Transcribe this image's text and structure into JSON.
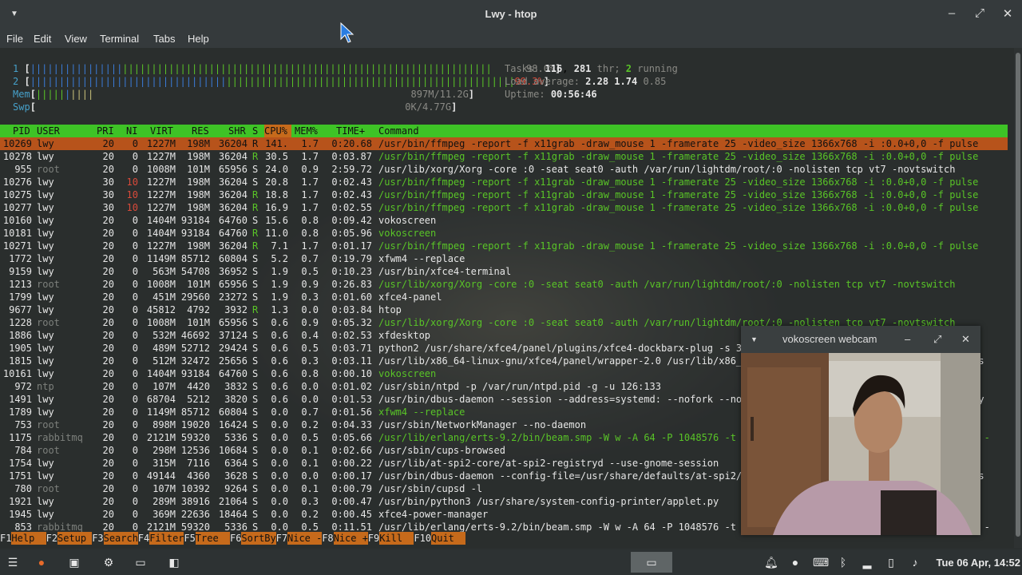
{
  "window": {
    "title": "Lwy - htop",
    "menu_icon": "chevron-down-icon",
    "minimize": "–",
    "maximize": "⤢",
    "close": "✕"
  },
  "menu": [
    "File",
    "Edit",
    "View",
    "Terminal",
    "Tabs",
    "Help"
  ],
  "meters": {
    "cpu1": {
      "label": "1",
      "value": "98.0%"
    },
    "cpu2": {
      "label": "2",
      "value": "99.3%"
    },
    "mem": {
      "label": "Mem",
      "value": "897M/11.2G"
    },
    "swp": {
      "label": "Swp",
      "value": "0K/4.77G"
    },
    "tasks_label": "Tasks:",
    "tasks": "116",
    "thr_count": "281",
    "thr_label": "thr;",
    "running": "2",
    "running_label": "running",
    "load_label": "Load average:",
    "load1": "2.28",
    "load5": "1.74",
    "load15": "0.85",
    "uptime_label": "Uptime:",
    "uptime": "00:56:46"
  },
  "columns": [
    "PID",
    "USER",
    "PRI",
    "NI",
    "VIRT",
    "RES",
    "SHR",
    "S",
    "CPU%",
    "MEM%",
    "TIME+",
    "Command"
  ],
  "processes": [
    {
      "pid": "10269",
      "user": "lwy",
      "pri": "20",
      "ni": "0",
      "virt": "1227M",
      "res": "198M",
      "shr": "36204",
      "s": "R",
      "cpu": "141.",
      "mem": "1.7",
      "time": "0:20.68",
      "cmd": "/usr/bin/ffmpeg -report -f x11grab -draw_mouse 1 -framerate 25 -video_size 1366x768 -i :0.0+0,0 -f pulse",
      "sel": true
    },
    {
      "pid": "10278",
      "user": "lwy",
      "pri": "20",
      "ni": "0",
      "virt": "1227M",
      "res": "198M",
      "shr": "36204",
      "s": "R",
      "cpu": "30.5",
      "mem": "1.7",
      "time": "0:03.87",
      "cmd": "/usr/bin/ffmpeg -report -f x11grab -draw_mouse 1 -framerate 25 -video_size 1366x768 -i :0.0+0,0 -f pulse",
      "thread": true
    },
    {
      "pid": "955",
      "user": "root",
      "pri": "20",
      "ni": "0",
      "virt": "1008M",
      "res": "101M",
      "shr": "65956",
      "s": "S",
      "cpu": "24.0",
      "mem": "0.9",
      "time": "2:59.72",
      "cmd": "/usr/lib/xorg/Xorg -core :0 -seat seat0 -auth /var/run/lightdm/root/:0 -nolisten tcp vt7 -novtswitch"
    },
    {
      "pid": "10276",
      "user": "lwy",
      "pri": "30",
      "ni": "10",
      "virt": "1227M",
      "res": "198M",
      "shr": "36204",
      "s": "S",
      "cpu": "20.8",
      "mem": "1.7",
      "time": "0:02.43",
      "cmd": "/usr/bin/ffmpeg -report -f x11grab -draw_mouse 1 -framerate 25 -video_size 1366x768 -i :0.0+0,0 -f pulse",
      "thread": true
    },
    {
      "pid": "10275",
      "user": "lwy",
      "pri": "30",
      "ni": "10",
      "virt": "1227M",
      "res": "198M",
      "shr": "36204",
      "s": "R",
      "cpu": "18.8",
      "mem": "1.7",
      "time": "0:02.43",
      "cmd": "/usr/bin/ffmpeg -report -f x11grab -draw_mouse 1 -framerate 25 -video_size 1366x768 -i :0.0+0,0 -f pulse",
      "thread": true
    },
    {
      "pid": "10277",
      "user": "lwy",
      "pri": "30",
      "ni": "10",
      "virt": "1227M",
      "res": "198M",
      "shr": "36204",
      "s": "R",
      "cpu": "16.9",
      "mem": "1.7",
      "time": "0:02.55",
      "cmd": "/usr/bin/ffmpeg -report -f x11grab -draw_mouse 1 -framerate 25 -video_size 1366x768 -i :0.0+0,0 -f pulse",
      "thread": true
    },
    {
      "pid": "10160",
      "user": "lwy",
      "pri": "20",
      "ni": "0",
      "virt": "1404M",
      "res": "93184",
      "shr": "64760",
      "s": "S",
      "cpu": "15.6",
      "mem": "0.8",
      "time": "0:09.42",
      "cmd": "vokoscreen"
    },
    {
      "pid": "10181",
      "user": "lwy",
      "pri": "20",
      "ni": "0",
      "virt": "1404M",
      "res": "93184",
      "shr": "64760",
      "s": "R",
      "cpu": "11.0",
      "mem": "0.8",
      "time": "0:05.96",
      "cmd": "vokoscreen",
      "thread": true
    },
    {
      "pid": "10271",
      "user": "lwy",
      "pri": "20",
      "ni": "0",
      "virt": "1227M",
      "res": "198M",
      "shr": "36204",
      "s": "R",
      "cpu": "7.1",
      "mem": "1.7",
      "time": "0:01.17",
      "cmd": "/usr/bin/ffmpeg -report -f x11grab -draw_mouse 1 -framerate 25 -video_size 1366x768 -i :0.0+0,0 -f pulse",
      "thread": true
    },
    {
      "pid": "1772",
      "user": "lwy",
      "pri": "20",
      "ni": "0",
      "virt": "1149M",
      "res": "85712",
      "shr": "60804",
      "s": "S",
      "cpu": "5.2",
      "mem": "0.7",
      "time": "0:19.79",
      "cmd": "xfwm4 --replace"
    },
    {
      "pid": "9159",
      "user": "lwy",
      "pri": "20",
      "ni": "0",
      "virt": "563M",
      "res": "54708",
      "shr": "36952",
      "s": "S",
      "cpu": "1.9",
      "mem": "0.5",
      "time": "0:10.23",
      "cmd": "/usr/bin/xfce4-terminal"
    },
    {
      "pid": "1213",
      "user": "root",
      "pri": "20",
      "ni": "0",
      "virt": "1008M",
      "res": "101M",
      "shr": "65956",
      "s": "S",
      "cpu": "1.9",
      "mem": "0.9",
      "time": "0:26.83",
      "cmd": "/usr/lib/xorg/Xorg -core :0 -seat seat0 -auth /var/run/lightdm/root/:0 -nolisten tcp vt7 -novtswitch",
      "thread": true
    },
    {
      "pid": "1799",
      "user": "lwy",
      "pri": "20",
      "ni": "0",
      "virt": "451M",
      "res": "29560",
      "shr": "23272",
      "s": "S",
      "cpu": "1.9",
      "mem": "0.3",
      "time": "0:01.60",
      "cmd": "xfce4-panel"
    },
    {
      "pid": "9677",
      "user": "lwy",
      "pri": "20",
      "ni": "0",
      "virt": "45812",
      "res": "4792",
      "shr": "3932",
      "s": "R",
      "cpu": "1.3",
      "mem": "0.0",
      "time": "0:03.84",
      "cmd": "htop"
    },
    {
      "pid": "1228",
      "user": "root",
      "pri": "20",
      "ni": "0",
      "virt": "1008M",
      "res": "101M",
      "shr": "65956",
      "s": "S",
      "cpu": "0.6",
      "mem": "0.9",
      "time": "0:05.32",
      "cmd": "/usr/lib/xorg/Xorg -core :0 -seat seat0 -auth /var/run/lightdm/root/:0 -nolisten tcp vt7 -novtswitch",
      "thread": true
    },
    {
      "pid": "1886",
      "user": "lwy",
      "pri": "20",
      "ni": "0",
      "virt": "532M",
      "res": "46692",
      "shr": "37124",
      "s": "S",
      "cpu": "0.6",
      "mem": "0.4",
      "time": "0:02.53",
      "cmd": "xfdesktop"
    },
    {
      "pid": "1905",
      "user": "lwy",
      "pri": "20",
      "ni": "0",
      "virt": "489M",
      "res": "52712",
      "shr": "29424",
      "s": "S",
      "cpu": "0.6",
      "mem": "0.5",
      "time": "0:03.71",
      "cmd": "python2 /usr/share/xfce4/panel/plugins/xfce4-dockbarx-plug -s 356616(? -i 21"
    },
    {
      "pid": "1815",
      "user": "lwy",
      "pri": "20",
      "ni": "0",
      "virt": "512M",
      "res": "32472",
      "shr": "25656",
      "s": "S",
      "cpu": "0.6",
      "mem": "0.3",
      "time": "0:03.11",
      "cmd": "/usr/lib/x86_64-linux-gnu/xfce4/panel/wrapper-2.0 /usr/lib/x86_64-linux-gnu/xfce4/panel/plugins/libstatus"
    },
    {
      "pid": "10161",
      "user": "lwy",
      "pri": "20",
      "ni": "0",
      "virt": "1404M",
      "res": "93184",
      "shr": "64760",
      "s": "S",
      "cpu": "0.6",
      "mem": "0.8",
      "time": "0:00.10",
      "cmd": "vokoscreen",
      "thread": true
    },
    {
      "pid": "972",
      "user": "ntp",
      "pri": "20",
      "ni": "0",
      "virt": "107M",
      "res": "4420",
      "shr": "3832",
      "s": "S",
      "cpu": "0.6",
      "mem": "0.0",
      "time": "0:01.02",
      "cmd": "/usr/sbin/ntpd -p /var/run/ntpd.pid -g -u 126:133"
    },
    {
      "pid": "1491",
      "user": "lwy",
      "pri": "20",
      "ni": "0",
      "virt": "68704",
      "res": "5212",
      "shr": "3820",
      "s": "S",
      "cpu": "0.6",
      "mem": "0.0",
      "time": "0:01.53",
      "cmd": "/usr/bin/dbus-daemon --session --address=systemd: --nofork --nopidfile --systemd-activation --syslog-only"
    },
    {
      "pid": "1789",
      "user": "lwy",
      "pri": "20",
      "ni": "0",
      "virt": "1149M",
      "res": "85712",
      "shr": "60804",
      "s": "S",
      "cpu": "0.0",
      "mem": "0.7",
      "time": "0:01.56",
      "cmd": "xfwm4 --replace",
      "thread": true
    },
    {
      "pid": "753",
      "user": "root",
      "pri": "20",
      "ni": "0",
      "virt": "898M",
      "res": "19020",
      "shr": "16424",
      "s": "S",
      "cpu": "0.0",
      "mem": "0.2",
      "time": "0:04.33",
      "cmd": "/usr/sbin/NetworkManager --no-daemon"
    },
    {
      "pid": "1175",
      "user": "rabbitmq",
      "pri": "20",
      "ni": "0",
      "virt": "2121M",
      "res": "59320",
      "shr": "5336",
      "s": "S",
      "cpu": "0.0",
      "mem": "0.5",
      "time": "0:05.66",
      "cmd": "/usr/lib/erlang/erts-9.2/bin/beam.smp -W w -A 64 -P 1048576 -t 5000000 -stbt db -zdbbl 128000 -K true -- -",
      "thread": true
    },
    {
      "pid": "784",
      "user": "root",
      "pri": "20",
      "ni": "0",
      "virt": "298M",
      "res": "12536",
      "shr": "10684",
      "s": "S",
      "cpu": "0.0",
      "mem": "0.1",
      "time": "0:02.66",
      "cmd": "/usr/sbin/cups-browsed"
    },
    {
      "pid": "1754",
      "user": "lwy",
      "pri": "20",
      "ni": "0",
      "virt": "315M",
      "res": "7116",
      "shr": "6364",
      "s": "S",
      "cpu": "0.0",
      "mem": "0.1",
      "time": "0:00.22",
      "cmd": "/usr/lib/at-spi2-core/at-spi2-registryd --use-gnome-session"
    },
    {
      "pid": "1751",
      "user": "lwy",
      "pri": "20",
      "ni": "0",
      "virt": "49144",
      "res": "4360",
      "shr": "3628",
      "s": "S",
      "cpu": "0.0",
      "mem": "0.0",
      "time": "0:00.17",
      "cmd": "/usr/bin/dbus-daemon --config-file=/usr/share/defaults/at-spi2/accessibility.conf --nofork --print-addres"
    },
    {
      "pid": "780",
      "user": "root",
      "pri": "20",
      "ni": "0",
      "virt": "107M",
      "res": "10392",
      "shr": "9264",
      "s": "S",
      "cpu": "0.0",
      "mem": "0.1",
      "time": "0:00.79",
      "cmd": "/usr/sbin/cupsd -l"
    },
    {
      "pid": "1921",
      "user": "lwy",
      "pri": "20",
      "ni": "0",
      "virt": "289M",
      "res": "38916",
      "shr": "21064",
      "s": "S",
      "cpu": "0.0",
      "mem": "0.3",
      "time": "0:00.47",
      "cmd": "/usr/bin/python3 /usr/share/system-config-printer/applet.py"
    },
    {
      "pid": "1945",
      "user": "lwy",
      "pri": "20",
      "ni": "0",
      "virt": "369M",
      "res": "22636",
      "shr": "18464",
      "s": "S",
      "cpu": "0.0",
      "mem": "0.2",
      "time": "0:00.45",
      "cmd": "xfce4-power-manager"
    },
    {
      "pid": "853",
      "user": "rabbitmq",
      "pri": "20",
      "ni": "0",
      "virt": "2121M",
      "res": "59320",
      "shr": "5336",
      "s": "S",
      "cpu": "0.0",
      "mem": "0.5",
      "time": "0:11.51",
      "cmd": "/usr/lib/erlang/erts-9.2/bin/beam.smp -W w -A 64 -P 1048576 -t 5000000 -stbt db -zdbbl 128000 -K true -- -"
    }
  ],
  "fkeys": [
    {
      "k": "F1",
      "l": "Help"
    },
    {
      "k": "F2",
      "l": "Setup"
    },
    {
      "k": "F3",
      "l": "Search"
    },
    {
      "k": "F4",
      "l": "Filter"
    },
    {
      "k": "F5",
      "l": "Tree"
    },
    {
      "k": "F6",
      "l": "SortBy"
    },
    {
      "k": "F7",
      "l": "Nice -"
    },
    {
      "k": "F8",
      "l": "Nice +"
    },
    {
      "k": "F9",
      "l": "Kill"
    },
    {
      "k": "F10",
      "l": "Quit"
    }
  ],
  "webcam": {
    "title": "vokoscreen webcam"
  },
  "taskbar": {
    "clock": "Tue 06 Apr, 14:52"
  },
  "colors": {
    "accent_green": "#3ec326",
    "selection": "#b7531b",
    "sort_column": "#c66a1b"
  }
}
